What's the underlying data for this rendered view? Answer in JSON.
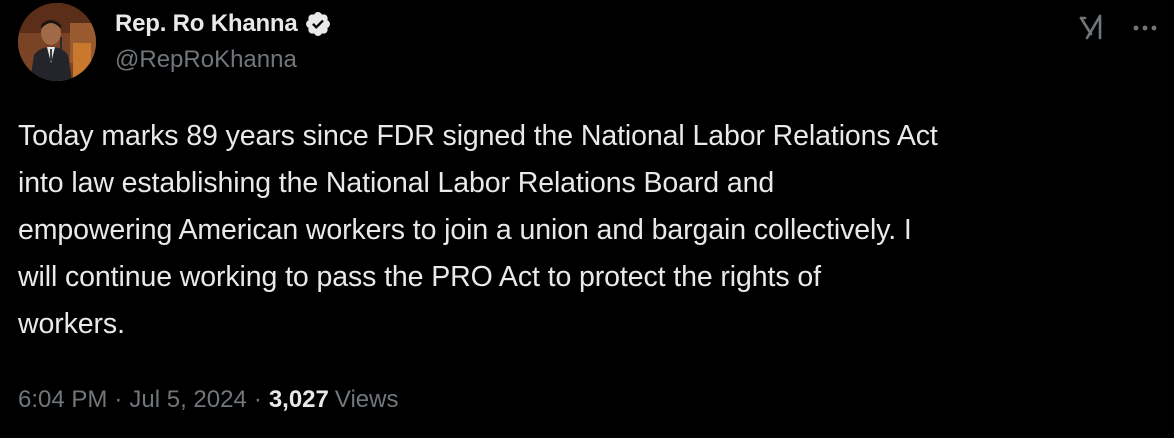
{
  "author": {
    "display_name": "Rep. Ro Khanna",
    "handle": "@RepRoKhanna",
    "verified": true
  },
  "icons": {
    "avatar": "avatar-photo",
    "verified": "verified-badge-icon",
    "grok": "grok-icon",
    "more": "more-options-icon"
  },
  "tweet": {
    "text": "Today marks 89 years since FDR signed the National Labor Relations Act\ninto law establishing the National Labor Relations Board and\nempowering American workers to join a union and bargain collectively. I\nwill continue working to pass the PRO Act to protect the rights of\nworkers.",
    "time": "6:04 PM",
    "date": "Jul 5, 2024",
    "separator": "·",
    "views_count": "3,027",
    "views_label": "Views"
  },
  "colors": {
    "background": "#000000",
    "primary_text": "#e7e9ea",
    "secondary_text": "#71767b",
    "verified_blue": "#1d9bf0"
  }
}
